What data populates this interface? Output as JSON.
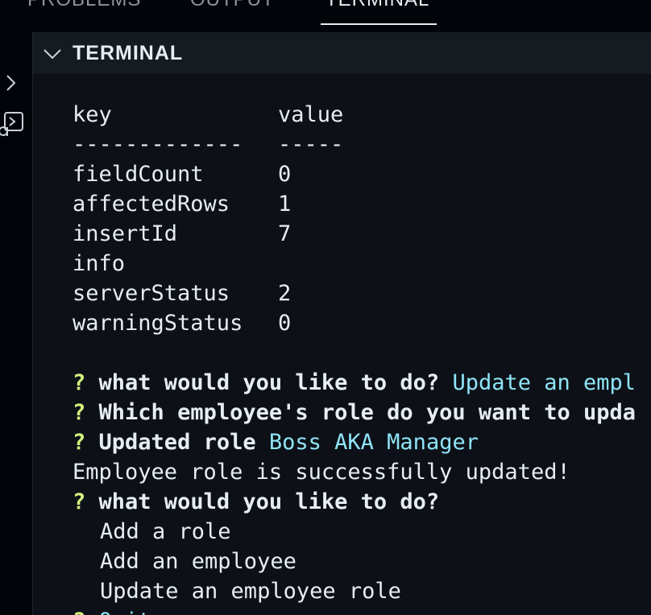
{
  "tabs": {
    "problems": "PROBLEMS",
    "output": "OUTPUT",
    "terminal": "TERMINAL"
  },
  "panel": {
    "title": "TERMINAL"
  },
  "icons": {
    "sidebar_toggle": "chevron-right-icon",
    "terminal": "terminal-icon",
    "collapse": "chevron-down-icon"
  },
  "colors": {
    "prompt_marker": "#d4f27f",
    "answer": "#8fe4f7",
    "text": "#e6edf3"
  },
  "table": {
    "header_key": "key",
    "header_value": "value",
    "sep_key": "-------------",
    "sep_value": "-----",
    "rows": [
      {
        "key": "fieldCount",
        "value": "0"
      },
      {
        "key": "affectedRows",
        "value": "1"
      },
      {
        "key": "insertId",
        "value": "7"
      },
      {
        "key": "info",
        "value": ""
      },
      {
        "key": "serverStatus",
        "value": "2"
      },
      {
        "key": "warningStatus",
        "value": "0"
      }
    ]
  },
  "prompts": [
    {
      "mark": "?",
      "question": "what would you like to do?",
      "answer": "Update an empl"
    },
    {
      "mark": "?",
      "question": "Which employee's role do you want to upda",
      "answer": ""
    },
    {
      "mark": "?",
      "question": "Updated role",
      "answer": "Boss AKA Manager"
    }
  ],
  "message": "Employee role is successfully updated!",
  "menu_prompt": {
    "mark": "?",
    "question": "what would you like to do?"
  },
  "menu_options": [
    "Add a role",
    "Add an employee",
    "Update an employee role"
  ],
  "partial_line": {
    "mark": "?",
    "text": "Quit"
  }
}
